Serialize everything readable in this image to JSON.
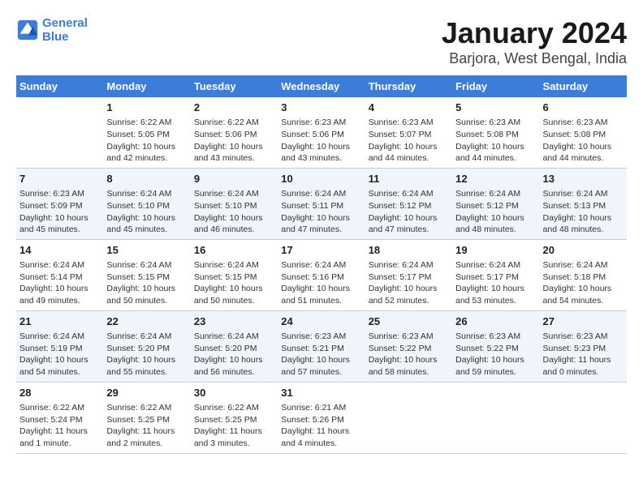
{
  "header": {
    "logo_line1": "General",
    "logo_line2": "Blue",
    "title": "January 2024",
    "subtitle": "Barjora, West Bengal, India"
  },
  "calendar": {
    "days_of_week": [
      "Sunday",
      "Monday",
      "Tuesday",
      "Wednesday",
      "Thursday",
      "Friday",
      "Saturday"
    ],
    "weeks": [
      [
        {
          "date": "",
          "info": ""
        },
        {
          "date": "1",
          "info": "Sunrise: 6:22 AM\nSunset: 5:05 PM\nDaylight: 10 hours\nand 42 minutes."
        },
        {
          "date": "2",
          "info": "Sunrise: 6:22 AM\nSunset: 5:06 PM\nDaylight: 10 hours\nand 43 minutes."
        },
        {
          "date": "3",
          "info": "Sunrise: 6:23 AM\nSunset: 5:06 PM\nDaylight: 10 hours\nand 43 minutes."
        },
        {
          "date": "4",
          "info": "Sunrise: 6:23 AM\nSunset: 5:07 PM\nDaylight: 10 hours\nand 44 minutes."
        },
        {
          "date": "5",
          "info": "Sunrise: 6:23 AM\nSunset: 5:08 PM\nDaylight: 10 hours\nand 44 minutes."
        },
        {
          "date": "6",
          "info": "Sunrise: 6:23 AM\nSunset: 5:08 PM\nDaylight: 10 hours\nand 44 minutes."
        }
      ],
      [
        {
          "date": "7",
          "info": "Sunrise: 6:23 AM\nSunset: 5:09 PM\nDaylight: 10 hours\nand 45 minutes."
        },
        {
          "date": "8",
          "info": "Sunrise: 6:24 AM\nSunset: 5:10 PM\nDaylight: 10 hours\nand 45 minutes."
        },
        {
          "date": "9",
          "info": "Sunrise: 6:24 AM\nSunset: 5:10 PM\nDaylight: 10 hours\nand 46 minutes."
        },
        {
          "date": "10",
          "info": "Sunrise: 6:24 AM\nSunset: 5:11 PM\nDaylight: 10 hours\nand 47 minutes."
        },
        {
          "date": "11",
          "info": "Sunrise: 6:24 AM\nSunset: 5:12 PM\nDaylight: 10 hours\nand 47 minutes."
        },
        {
          "date": "12",
          "info": "Sunrise: 6:24 AM\nSunset: 5:12 PM\nDaylight: 10 hours\nand 48 minutes."
        },
        {
          "date": "13",
          "info": "Sunrise: 6:24 AM\nSunset: 5:13 PM\nDaylight: 10 hours\nand 48 minutes."
        }
      ],
      [
        {
          "date": "14",
          "info": "Sunrise: 6:24 AM\nSunset: 5:14 PM\nDaylight: 10 hours\nand 49 minutes."
        },
        {
          "date": "15",
          "info": "Sunrise: 6:24 AM\nSunset: 5:15 PM\nDaylight: 10 hours\nand 50 minutes."
        },
        {
          "date": "16",
          "info": "Sunrise: 6:24 AM\nSunset: 5:15 PM\nDaylight: 10 hours\nand 50 minutes."
        },
        {
          "date": "17",
          "info": "Sunrise: 6:24 AM\nSunset: 5:16 PM\nDaylight: 10 hours\nand 51 minutes."
        },
        {
          "date": "18",
          "info": "Sunrise: 6:24 AM\nSunset: 5:17 PM\nDaylight: 10 hours\nand 52 minutes."
        },
        {
          "date": "19",
          "info": "Sunrise: 6:24 AM\nSunset: 5:17 PM\nDaylight: 10 hours\nand 53 minutes."
        },
        {
          "date": "20",
          "info": "Sunrise: 6:24 AM\nSunset: 5:18 PM\nDaylight: 10 hours\nand 54 minutes."
        }
      ],
      [
        {
          "date": "21",
          "info": "Sunrise: 6:24 AM\nSunset: 5:19 PM\nDaylight: 10 hours\nand 54 minutes."
        },
        {
          "date": "22",
          "info": "Sunrise: 6:24 AM\nSunset: 5:20 PM\nDaylight: 10 hours\nand 55 minutes."
        },
        {
          "date": "23",
          "info": "Sunrise: 6:24 AM\nSunset: 5:20 PM\nDaylight: 10 hours\nand 56 minutes."
        },
        {
          "date": "24",
          "info": "Sunrise: 6:23 AM\nSunset: 5:21 PM\nDaylight: 10 hours\nand 57 minutes."
        },
        {
          "date": "25",
          "info": "Sunrise: 6:23 AM\nSunset: 5:22 PM\nDaylight: 10 hours\nand 58 minutes."
        },
        {
          "date": "26",
          "info": "Sunrise: 6:23 AM\nSunset: 5:22 PM\nDaylight: 10 hours\nand 59 minutes."
        },
        {
          "date": "27",
          "info": "Sunrise: 6:23 AM\nSunset: 5:23 PM\nDaylight: 11 hours\nand 0 minutes."
        }
      ],
      [
        {
          "date": "28",
          "info": "Sunrise: 6:22 AM\nSunset: 5:24 PM\nDaylight: 11 hours\nand 1 minute."
        },
        {
          "date": "29",
          "info": "Sunrise: 6:22 AM\nSunset: 5:25 PM\nDaylight: 11 hours\nand 2 minutes."
        },
        {
          "date": "30",
          "info": "Sunrise: 6:22 AM\nSunset: 5:25 PM\nDaylight: 11 hours\nand 3 minutes."
        },
        {
          "date": "31",
          "info": "Sunrise: 6:21 AM\nSunset: 5:26 PM\nDaylight: 11 hours\nand 4 minutes."
        },
        {
          "date": "",
          "info": ""
        },
        {
          "date": "",
          "info": ""
        },
        {
          "date": "",
          "info": ""
        }
      ]
    ]
  }
}
